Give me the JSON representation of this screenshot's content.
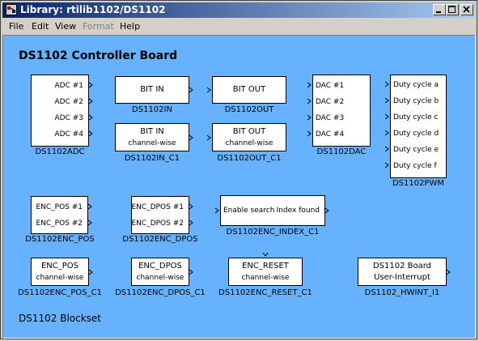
{
  "window": {
    "title": "Library: rtilib1102/DS1102",
    "minimize_icon": "minimize-icon",
    "maximize_icon": "maximize-icon",
    "close_icon": "close-icon"
  },
  "menu": {
    "file": "File",
    "edit": "Edit",
    "view": "View",
    "format": "Format",
    "help": "Help"
  },
  "canvas": {
    "heading": "DS1102 Controller Board",
    "footer": "DS1102 Blockset",
    "background": "#66b2ff"
  },
  "blocks": {
    "adc": {
      "name": "DS1102ADC",
      "ports": [
        "ADC #1",
        "ADC #2",
        "ADC #3",
        "ADC #4"
      ]
    },
    "bitin": {
      "name": "DS1102IN",
      "label": "BIT IN"
    },
    "bitout": {
      "name": "DS1102OUT",
      "label": "BIT OUT"
    },
    "bitin_c1": {
      "name": "DS1102IN_C1",
      "line1": "BIT IN",
      "line2": "channel-wise"
    },
    "bitout_c1": {
      "name": "DS1102OUT_C1",
      "line1": "BIT OUT",
      "line2": "channel-wise"
    },
    "dac": {
      "name": "DS1102DAC",
      "ports": [
        "DAC #1",
        "DAC #2",
        "DAC #3",
        "DAC #4"
      ]
    },
    "pwm": {
      "name": "DS1102PWM",
      "ports": [
        "Duty cycle a",
        "Duty cycle b",
        "Duty cycle c",
        "Duty cycle d",
        "Duty cycle e",
        "Duty cycle f"
      ]
    },
    "enc_pos": {
      "name": "DS1102ENC_POS",
      "ports": [
        "ENC_POS #1",
        "ENC_POS #2"
      ]
    },
    "enc_dpos": {
      "name": "DS1102ENC_DPOS",
      "ports": [
        "ENC_DPOS #1",
        "ENC_DPOS #2"
      ]
    },
    "enc_index": {
      "name": "DS1102ENC_INDEX_C1",
      "in_label": "Enable search",
      "out_label": "Index found"
    },
    "enc_pos_c1": {
      "name": "DS1102ENC_POS_C1",
      "line1": "ENC_POS",
      "line2": "channel-wise"
    },
    "enc_dpos_c1": {
      "name": "DS1102ENC_DPOS_C1",
      "line1": "ENC_DPOS",
      "line2": "channel-wise"
    },
    "enc_reset_c1": {
      "name": "DS1102ENC_RESET_C1",
      "line1": "ENC_RESET",
      "line2": "channel-wise"
    },
    "hwint": {
      "name": "DS1102_HWINT_I1",
      "line1": "DS1102 Board",
      "line2": "User-Interrupt"
    }
  }
}
